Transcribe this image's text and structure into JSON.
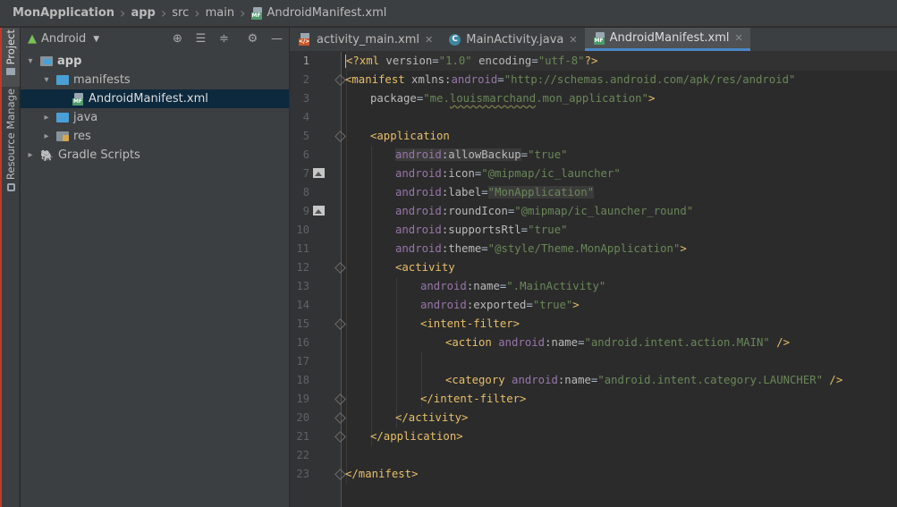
{
  "breadcrumb": {
    "items": [
      "MonApplication",
      "app",
      "src",
      "main",
      "AndroidManifest.xml"
    ]
  },
  "left_stripe": {
    "project_tab": "Project",
    "resource_tab": "Resource Manage"
  },
  "project_panel": {
    "view_mode": "Android",
    "tree": [
      {
        "label": "app",
        "depth": 0,
        "expanded": true
      },
      {
        "label": "manifests",
        "depth": 1,
        "expanded": true
      },
      {
        "label": "AndroidManifest.xml",
        "depth": 2,
        "selected": true
      },
      {
        "label": "java",
        "depth": 1,
        "expanded": false
      },
      {
        "label": "res",
        "depth": 1,
        "expanded": false
      },
      {
        "label": "Gradle Scripts",
        "depth": 0,
        "expanded": false
      }
    ]
  },
  "editor_tabs": [
    {
      "label": "activity_main.xml",
      "icon": "layout-xml-icon",
      "active": false
    },
    {
      "label": "MainActivity.java",
      "icon": "java-class-icon",
      "active": false
    },
    {
      "label": "AndroidManifest.xml",
      "icon": "manifest-icon",
      "active": true
    }
  ],
  "editor": {
    "line_numbers": [
      "1",
      "2",
      "3",
      "4",
      "5",
      "6",
      "7",
      "8",
      "9",
      "10",
      "11",
      "12",
      "13",
      "14",
      "15",
      "16",
      "17",
      "18",
      "19",
      "20",
      "21",
      "22",
      "23"
    ],
    "code": {
      "l1_open": "<?",
      "l1_name": "xml",
      "l1_a1": " version",
      "l1_v1": "\"1.0\"",
      "l1_a2": " encoding",
      "l1_v2": "\"utf-8\"",
      "l1_close": "?>",
      "l2_tag": "<manifest",
      "l2_attr": " xmlns:",
      "l2_ns": "android",
      "l2_val": "\"http://schemas.android.com/apk/res/android\"",
      "l3_attr": "package",
      "l3_val_a": "\"me.",
      "l3_val_b": "louismarchand",
      "l3_val_c": ".mon_application\"",
      "l3_close": ">",
      "l5_tag": "<application",
      "l6_ns": "android",
      "l6_attr": "allowBackup",
      "l6_val": "\"true\"",
      "l7_ns": "android",
      "l7_attr": "icon",
      "l7_val": "\"@mipmap/ic_launcher\"",
      "l8_ns": "android",
      "l8_attr": "label",
      "l8_val": "\"MonApplication\"",
      "l9_ns": "android",
      "l9_attr": "roundIcon",
      "l9_val": "\"@mipmap/ic_launcher_round\"",
      "l10_ns": "android",
      "l10_attr": "supportsRtl",
      "l10_val": "\"true\"",
      "l11_ns": "android",
      "l11_attr": "theme",
      "l11_val": "\"@style/Theme.MonApplication\"",
      "l11_close": ">",
      "l12_tag": "<activity",
      "l13_ns": "android",
      "l13_attr": "name",
      "l13_val": "\".MainActivity\"",
      "l14_ns": "android",
      "l14_attr": "exported",
      "l14_val": "\"true\"",
      "l14_close": ">",
      "l15_tag": "<intent-filter>",
      "l16_tag": "<action",
      "l16_ns": "android",
      "l16_attr": "name",
      "l16_val": "\"android.intent.action.MAIN\"",
      "l16_close": " />",
      "l18_tag": "<category",
      "l18_ns": "android",
      "l18_attr": "name",
      "l18_val": "\"android.intent.category.LAUNCHER\"",
      "l18_close": " />",
      "l19_tag": "</intent-filter>",
      "l20_tag": "</activity>",
      "l21_tag": "</application>",
      "l23_tag": "</manifest>"
    }
  }
}
